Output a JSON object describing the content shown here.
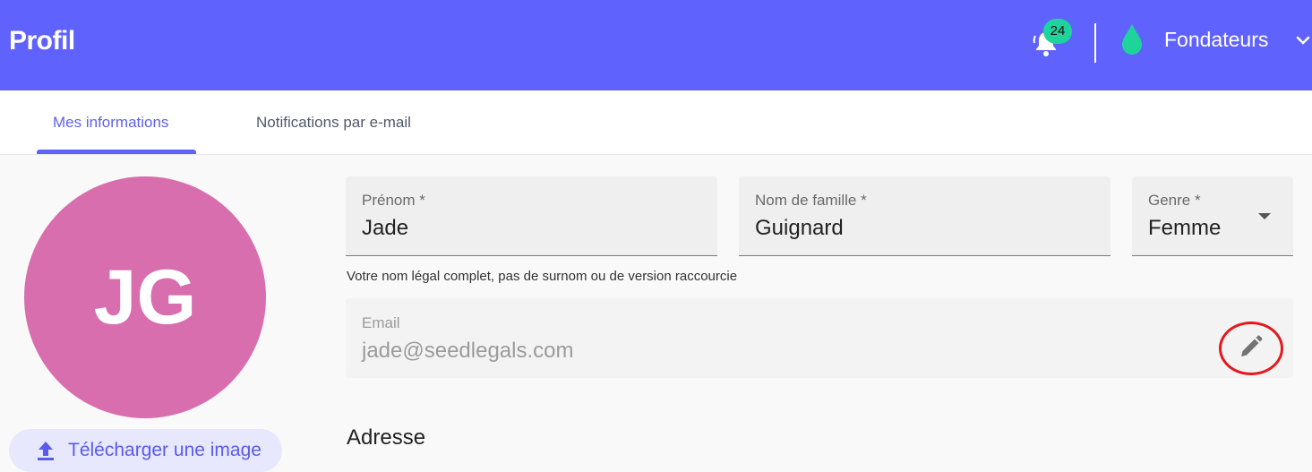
{
  "header": {
    "title": "Profil",
    "notification_count": "24",
    "company_name": "Fondateurs",
    "icons": [
      "bell-icon",
      "drop-logo-icon",
      "chevron-down-icon"
    ]
  },
  "tabs": [
    {
      "label": "Mes informations",
      "active": true
    },
    {
      "label": "Notifications par e-mail",
      "active": false
    }
  ],
  "profile": {
    "initials": "JG",
    "upload_label": "Télécharger une image"
  },
  "form": {
    "first_name": {
      "label": "Prénom *",
      "value": "Jade"
    },
    "last_name": {
      "label": "Nom de famille *",
      "value": "Guignard"
    },
    "gender": {
      "label": "Genre *",
      "value": "Femme"
    },
    "name_helper": "Votre nom légal complet, pas de surnom ou de version raccourcie",
    "email": {
      "label": "Email",
      "value": "jade@seedlegals.com"
    },
    "address_title": "Adresse"
  },
  "colors": {
    "brand": "#6062fe",
    "badge": "#1fd49a",
    "avatar": "#d86ead",
    "highlight": "#e5171d"
  }
}
